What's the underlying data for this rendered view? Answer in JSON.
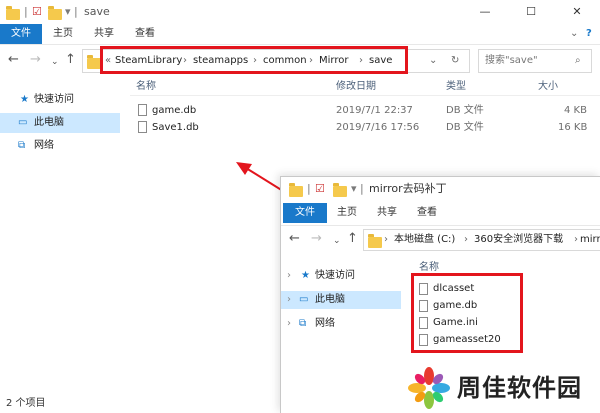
{
  "main": {
    "title": "save",
    "ribbon_tabs": [
      "文件",
      "主页",
      "共享",
      "查看"
    ],
    "path": [
      "SteamLibrary",
      "steamapps",
      "common",
      "Mirror",
      "save"
    ],
    "search_placeholder": "搜索\"save\"",
    "columns": {
      "name": "名称",
      "date": "修改日期",
      "type": "类型",
      "size": "大小"
    },
    "files": [
      {
        "name": "game.db",
        "date": "2019/7/1 22:37",
        "type": "DB 文件",
        "size": "4 KB"
      },
      {
        "name": "Save1.db",
        "date": "2019/7/16 17:56",
        "type": "DB 文件",
        "size": "16 KB"
      }
    ],
    "sidebar": [
      {
        "label": "快速访问",
        "icon": "star-icon"
      },
      {
        "label": "此电脑",
        "icon": "computer-icon"
      },
      {
        "label": "网络",
        "icon": "network-icon"
      }
    ],
    "status": "2 个项目"
  },
  "secondary": {
    "title": "mirror去码补丁",
    "ribbon_tabs": [
      "文件",
      "主页",
      "共享",
      "查看"
    ],
    "path": [
      "本地磁盘 (C:)",
      "360安全浏览器下载",
      "mirror去"
    ],
    "column_name": "名称",
    "sidebar": [
      {
        "label": "快速访问"
      },
      {
        "label": "此电脑"
      },
      {
        "label": "网络"
      }
    ],
    "files": [
      "dlcasset",
      "game.db",
      "Game.ini",
      "gameasset20"
    ]
  },
  "watermark": "周佳软件园",
  "colors": {
    "accent": "#1979ca",
    "highlight": "#e3151d",
    "selection": "#cce8ff"
  }
}
